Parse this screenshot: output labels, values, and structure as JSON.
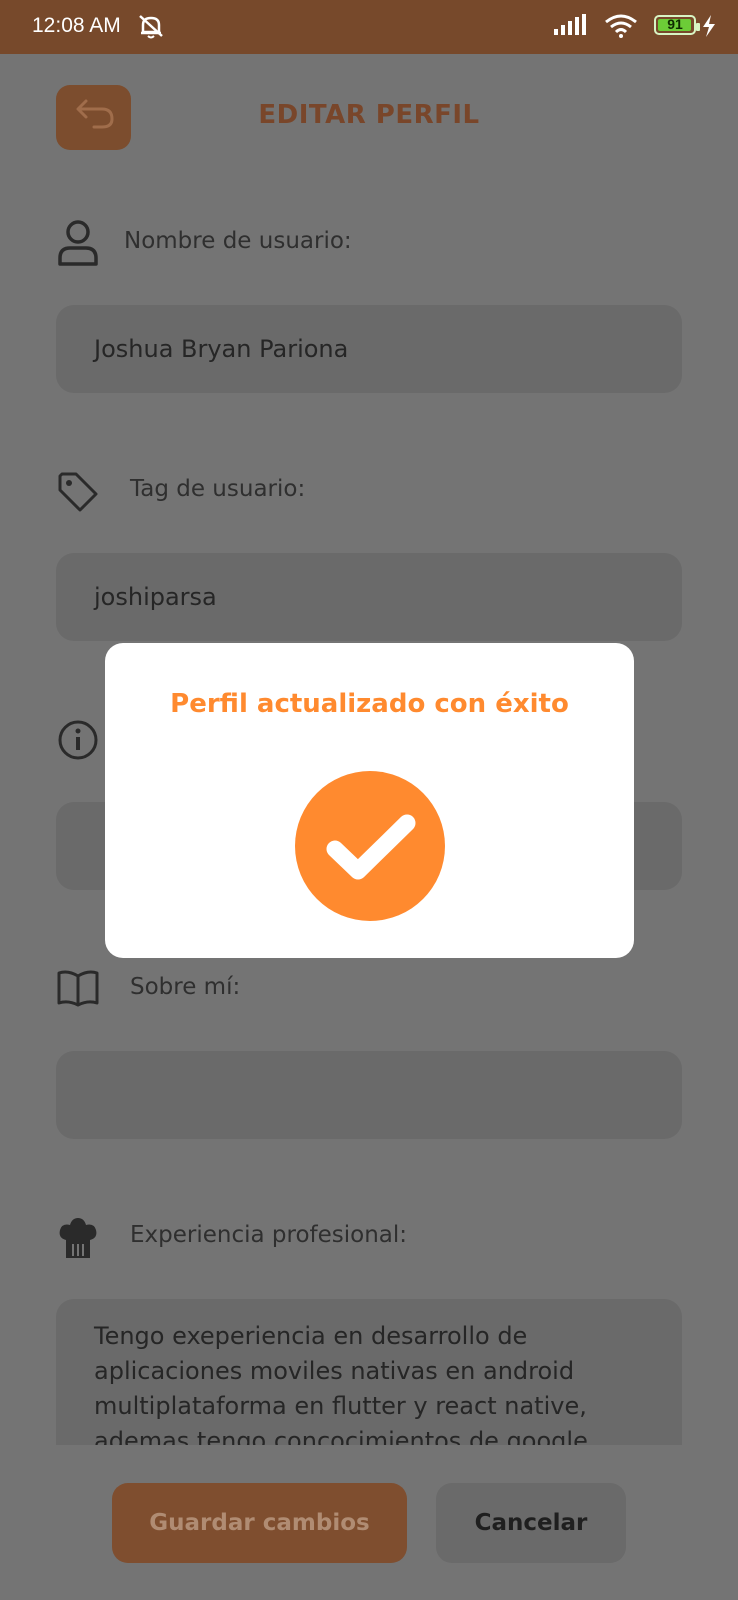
{
  "status_bar": {
    "time": "12:08 AM",
    "battery": "91",
    "icons": [
      "muted-bell-icon",
      "signal-icon",
      "wifi-icon",
      "battery-icon",
      "charging-bolt-icon"
    ]
  },
  "header": {
    "title": "EDITAR PERFIL",
    "back_icon": "back-arrow-icon"
  },
  "form": {
    "username_label": "Nombre de usuario:",
    "username_value": "Joshua Bryan Pariona",
    "tag_label": "Tag de usuario:",
    "tag_value": "joshiparsa",
    "about_label": "Sobre mí:",
    "experience_label": "Experiencia profesional:",
    "experience_lines": [
      "Tengo exeperiencia en desarrollo de",
      "aplicaciones moviles nativas en android",
      "multiplataforma en flutter y react native,",
      "ademas tengo concocimientos de google"
    ]
  },
  "actions": {
    "save_label": "Guardar cambios",
    "cancel_label": "Cancelar"
  },
  "modal": {
    "title": "Perfil actualizado con éxito",
    "icon": "success-check-icon"
  },
  "colors": {
    "accent": "#ff8a2f",
    "status_bar": "#77492b",
    "overlay": "#747474"
  }
}
